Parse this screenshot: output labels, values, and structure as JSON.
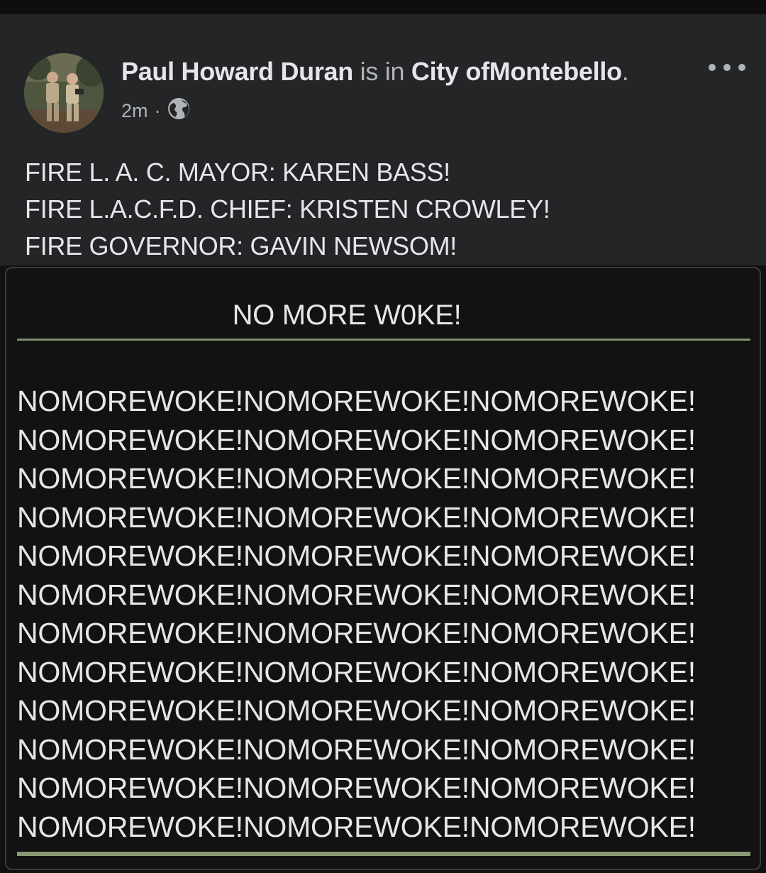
{
  "post": {
    "author_name": "Paul Howard Duran",
    "is_in_text": "is in",
    "location": "City ofMontebello",
    "period": ".",
    "timestamp": "2m",
    "separator": "·",
    "audience_icon": "globe-icon",
    "more_icon": "more-options-icon",
    "text_lines": [
      "FIRE L. A. C. MAYOR: KAREN BASS!",
      "FIRE L.A.C.F.D. CHIEF: KRISTEN CROWLEY!",
      "FIRE GOVERNOR: GAVIN NEWSOM!"
    ]
  },
  "card": {
    "title": "NO MORE W0KE!",
    "lines": [
      "NOMOREWOKE!NOMOREWOKE!NOMOREWOKE!",
      "NOMOREWOKE!NOMOREWOKE!NOMOREWOKE!",
      "NOMOREWOKE!NOMOREWOKE!NOMOREWOKE!",
      "NOMOREWOKE!NOMOREWOKE!NOMOREWOKE!",
      "NOMOREWOKE!NOMOREWOKE!NOMOREWOKE!",
      "NOMOREWOKE!NOMOREWOKE!NOMOREWOKE!",
      "NOMOREWOKE!NOMOREWOKE!NOMOREWOKE!",
      "NOMOREWOKE!NOMOREWOKE!NOMOREWOKE!",
      "NOMOREWOKE!NOMOREWOKE!NOMOREWOKE!",
      "NOMOREWOKE!NOMOREWOKE!NOMOREWOKE!",
      "NOMOREWOKE!NOMOREWOKE!NOMOREWOKE!",
      "NOMOREWOKE!NOMOREWOKE!NOMOREWOKE!"
    ],
    "rule_color": "#7e8d6b"
  },
  "colors": {
    "post_background": "#242526",
    "card_background": "#121212",
    "primary_text": "#e4e6eb",
    "secondary_text": "#b0b3b8"
  }
}
